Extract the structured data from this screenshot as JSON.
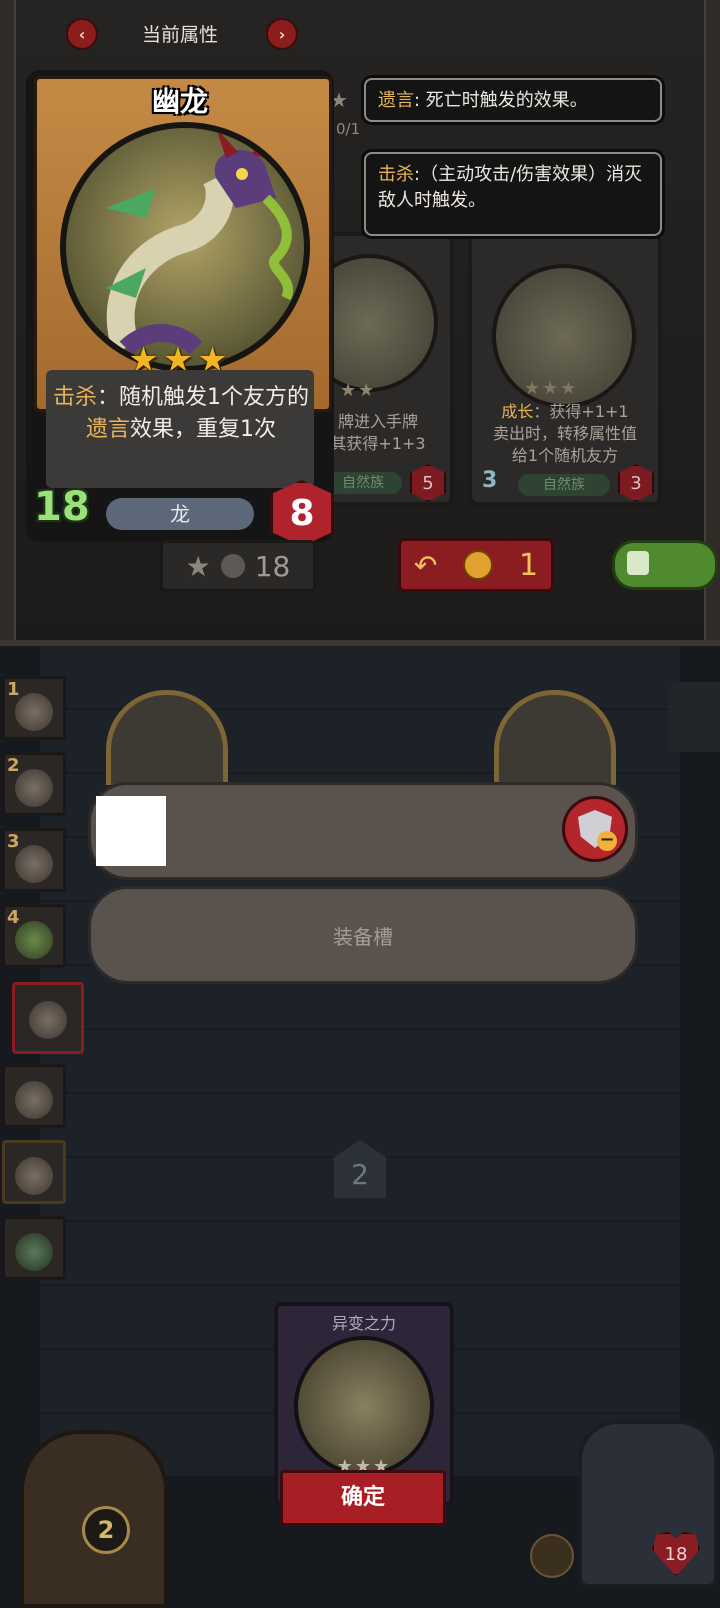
{
  "header": {
    "title": "当前属性",
    "prev_icon": "chevron-left-icon",
    "next_icon": "chevron-right-icon"
  },
  "main_card": {
    "name": "幽龙",
    "stars": "★★★",
    "desc_kw1": "击杀",
    "desc_part1": "：随机触发1个友方的",
    "desc_kw2": "遗言",
    "desc_part2": "效果，重复1次",
    "attack": "18",
    "tribe": "龙",
    "health": "8",
    "colors": {
      "frame": "#c48a45",
      "keyword": "#e7b45a",
      "star": "#f4b524",
      "attack": "#9be07a",
      "health": "#b0232c"
    }
  },
  "tooltips": [
    {
      "keyword": "遗言",
      "text": ": 死亡时触发的效果。"
    },
    {
      "keyword": "击杀",
      "text": ":（主动攻击/伤害效果）消灭敌人时触发。"
    }
  ],
  "bg_cards": {
    "partial_count": "0/1",
    "card1": {
      "stars": "★★",
      "text1": "牌进入手牌",
      "text2": "其获得+1+3",
      "tribe": "自然族",
      "health": "5"
    },
    "card2": {
      "stars": "★★★",
      "kw": "成长",
      "text1": "：获得+1+1",
      "text2": "卖出时，转移属性值",
      "text3": "给1个随机友方",
      "attack": "3",
      "tribe": "自然族",
      "health": "3"
    }
  },
  "toolbar": {
    "upgrade_cost": "18",
    "refresh_cost": "1",
    "icons": {
      "upgrade": "star-up-icon",
      "coin": "coin-icon",
      "refresh": "refresh-icon",
      "lock": "lock-icon"
    }
  },
  "sidebar": {
    "slots": [
      {
        "num": "1"
      },
      {
        "num": "2"
      },
      {
        "num": "3"
      },
      {
        "num": "4"
      },
      {
        "num": ""
      },
      {
        "num": ""
      },
      {
        "num": ""
      },
      {
        "num": ""
      }
    ]
  },
  "board": {
    "equip_slot_label": "装备槽",
    "page_number": "2",
    "remove_icon": "shield-minus-icon"
  },
  "selected_card": {
    "title": "异变之力",
    "stars": "★★★",
    "confirm_label": "确定"
  },
  "corner": {
    "gold": "2",
    "hero_health": "18"
  }
}
